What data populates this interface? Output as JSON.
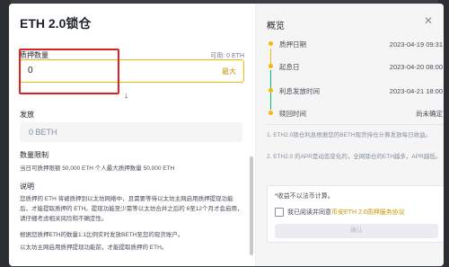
{
  "modal": {
    "title": "ETH 2.0锁仓",
    "stake": {
      "label": "质押数量",
      "available": "可用: 0 ETH",
      "value": "0",
      "max": "最大"
    },
    "issue": {
      "label": "发放",
      "value": "0 BETH"
    },
    "limit": {
      "label": "数量限制",
      "text": "当日可质押限额 50,000 ETH    个人最大质押数量 50,000 ETH"
    },
    "desc": {
      "heading": "说明",
      "p1": "您质押的 ETH 将被质押到以太坊网络中，且需要等待以太坊主网启用质押提现功能后，才能提取质押的 ETH。提现功能至少需等以太坊合并之后的 6至12个月才会启用，请仔细考虑相关风险和不确定性。",
      "p2": "根据您质押ETH的数量1:1比例实时发放BETH至您的现货账户。",
      "p3": "以太坊主网启用质押提现功能前，才能提取质押的 ETH。"
    }
  },
  "overview": {
    "title": "概览",
    "steps": [
      {
        "label": "质押日期",
        "value": "2023-04-19 09:31"
      },
      {
        "label": "起息日",
        "value": "2023-04-20 08:00"
      },
      {
        "label": "利息发放时间",
        "value": "2023-04-21 18:00"
      },
      {
        "label": "赎回时间",
        "value": "尚未确定"
      }
    ],
    "notes": [
      "1. ETH2.0锁仓利息根据您的BETH现货持仓计算发放每日收益。",
      "2. ETH2.0 的APR是动态变化的，全网锁仓的ETH越多，APR越低。"
    ],
    "estimate": "*收益不以法币计算。",
    "agree_prefix": "我已阅读并同意",
    "agree_link": "币安ETH 2.0质押服务协议",
    "confirm": "确认"
  },
  "colors": {
    "accent": "#f0b90b",
    "highlight": "#dd2222",
    "teal": "#02c076"
  }
}
